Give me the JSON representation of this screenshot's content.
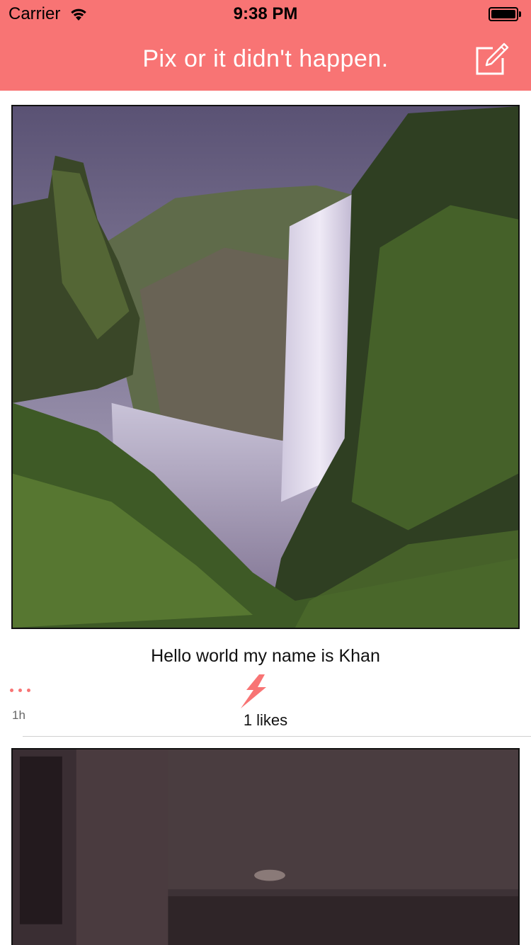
{
  "status_bar": {
    "carrier": "Carrier",
    "time": "9:38 PM"
  },
  "nav": {
    "title": "Pix or it didn't happen.",
    "compose_icon": "compose-icon"
  },
  "colors": {
    "accent": "#F87474",
    "nav_title": "#FFFFFF"
  },
  "feed": {
    "posts": [
      {
        "image": "waterfall-photo",
        "caption": "Hello world my name is Khan",
        "age": "1h",
        "likes": "1 likes",
        "more_icon": "ellipsis-icon",
        "like_icon": "lightning-bolt-icon"
      },
      {
        "image": "indoor-ceiling-photo"
      }
    ]
  }
}
